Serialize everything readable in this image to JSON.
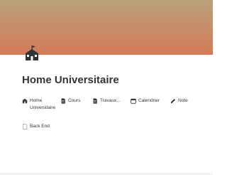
{
  "page": {
    "title": "Home Universitaire",
    "icon": "school-building-icon",
    "cover_colors": [
      "#b6a27a",
      "#c68e6a",
      "#d47a56"
    ]
  },
  "links": [
    {
      "label": "Home Universitaire",
      "icon": "school-icon"
    },
    {
      "label": "Cours",
      "icon": "document-icon"
    },
    {
      "label": "Travaux...",
      "icon": "document-icon"
    },
    {
      "label": "Calendrier",
      "icon": "calendar-icon"
    },
    {
      "label": "Note",
      "icon": "pencil-icon"
    },
    {
      "label": "Back End",
      "icon": "page-icon"
    }
  ]
}
